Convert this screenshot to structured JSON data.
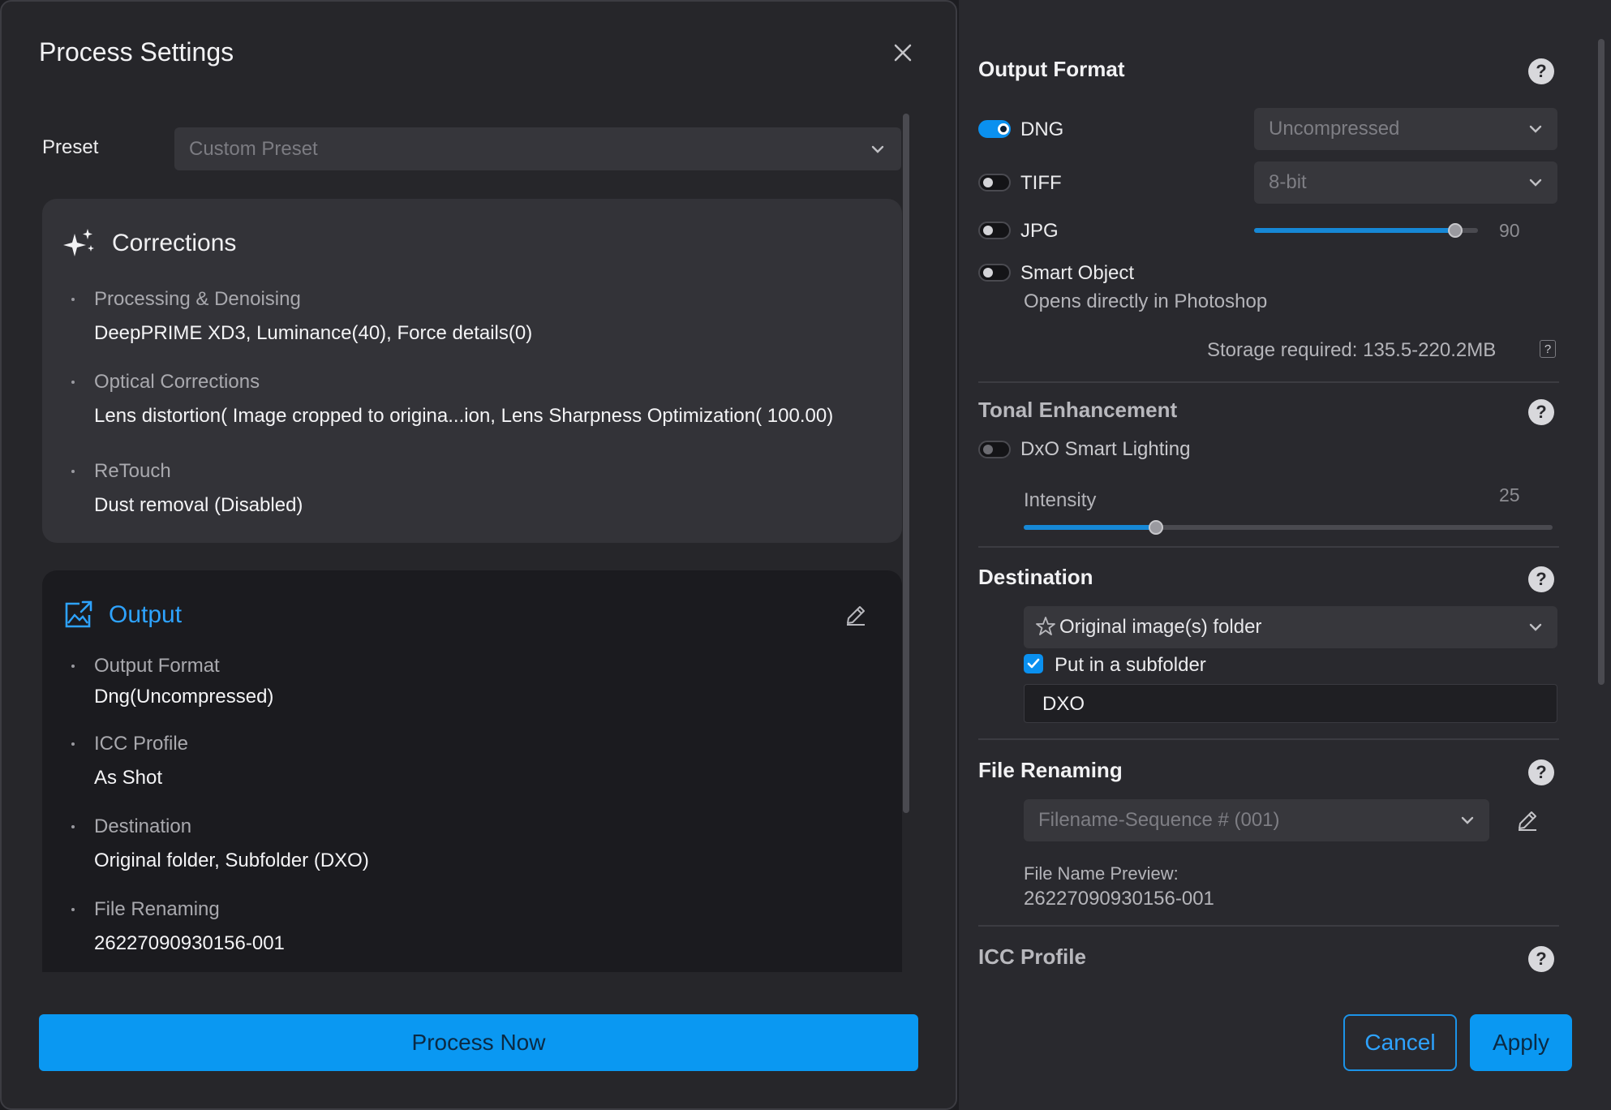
{
  "dialog": {
    "title": "Process Settings",
    "preset_label": "Preset",
    "preset_value": "Custom Preset"
  },
  "corrections": {
    "title": "Corrections",
    "items": [
      {
        "label": "Processing & Denoising",
        "value": "DeepPRIME XD3, Luminance(40), Force details(0)"
      },
      {
        "label": "Optical Corrections",
        "value": "Lens distortion( Image cropped to origina...ion, Lens Sharpness Optimization( 100.00)"
      },
      {
        "label": "ReTouch",
        "value": "Dust removal (Disabled)"
      }
    ]
  },
  "output": {
    "title": "Output",
    "items": [
      {
        "label": "Output Format",
        "value": "Dng(Uncompressed)"
      },
      {
        "label": "ICC Profile",
        "value": "As Shot"
      },
      {
        "label": "Destination",
        "value": "Original folder, Subfolder (DXO)"
      },
      {
        "label": "File Renaming",
        "value": "26227090930156-001"
      }
    ]
  },
  "process_button": "Process Now",
  "output_format": {
    "title": "Output Format",
    "dng": {
      "label": "DNG",
      "enabled": true,
      "option": "Uncompressed"
    },
    "tiff": {
      "label": "TIFF",
      "enabled": false,
      "option": "8-bit"
    },
    "jpg": {
      "label": "JPG",
      "enabled": false,
      "quality": 90
    },
    "smart_object": {
      "label": "Smart Object",
      "enabled": false,
      "subtitle": "Opens directly in Photoshop"
    },
    "storage": "Storage required: 135.5-220.2MB",
    "storage_help": "?"
  },
  "tonal": {
    "title": "Tonal Enhancement",
    "smart_lighting": {
      "label": "DxO Smart Lighting",
      "enabled": false
    },
    "intensity_label": "Intensity",
    "intensity_value": 25,
    "intensity_max": 100
  },
  "destination": {
    "title": "Destination",
    "folder": "Original image(s) folder",
    "subfolder_label": "Put in a subfolder",
    "subfolder_checked": true,
    "subfolder_name": "DXO"
  },
  "file_renaming": {
    "title": "File Renaming",
    "pattern": "Filename-Sequence # (001)",
    "preview_label": "File Name Preview:",
    "preview_value": "26227090930156-001"
  },
  "icc": {
    "title": "ICC Profile"
  },
  "help_glyph": "?",
  "buttons": {
    "cancel": "Cancel",
    "apply": "Apply"
  },
  "colors": {
    "accent": "#0a98f2",
    "accent_text": "#2ea3ff",
    "panel": "#26262a",
    "card": "#333338"
  }
}
